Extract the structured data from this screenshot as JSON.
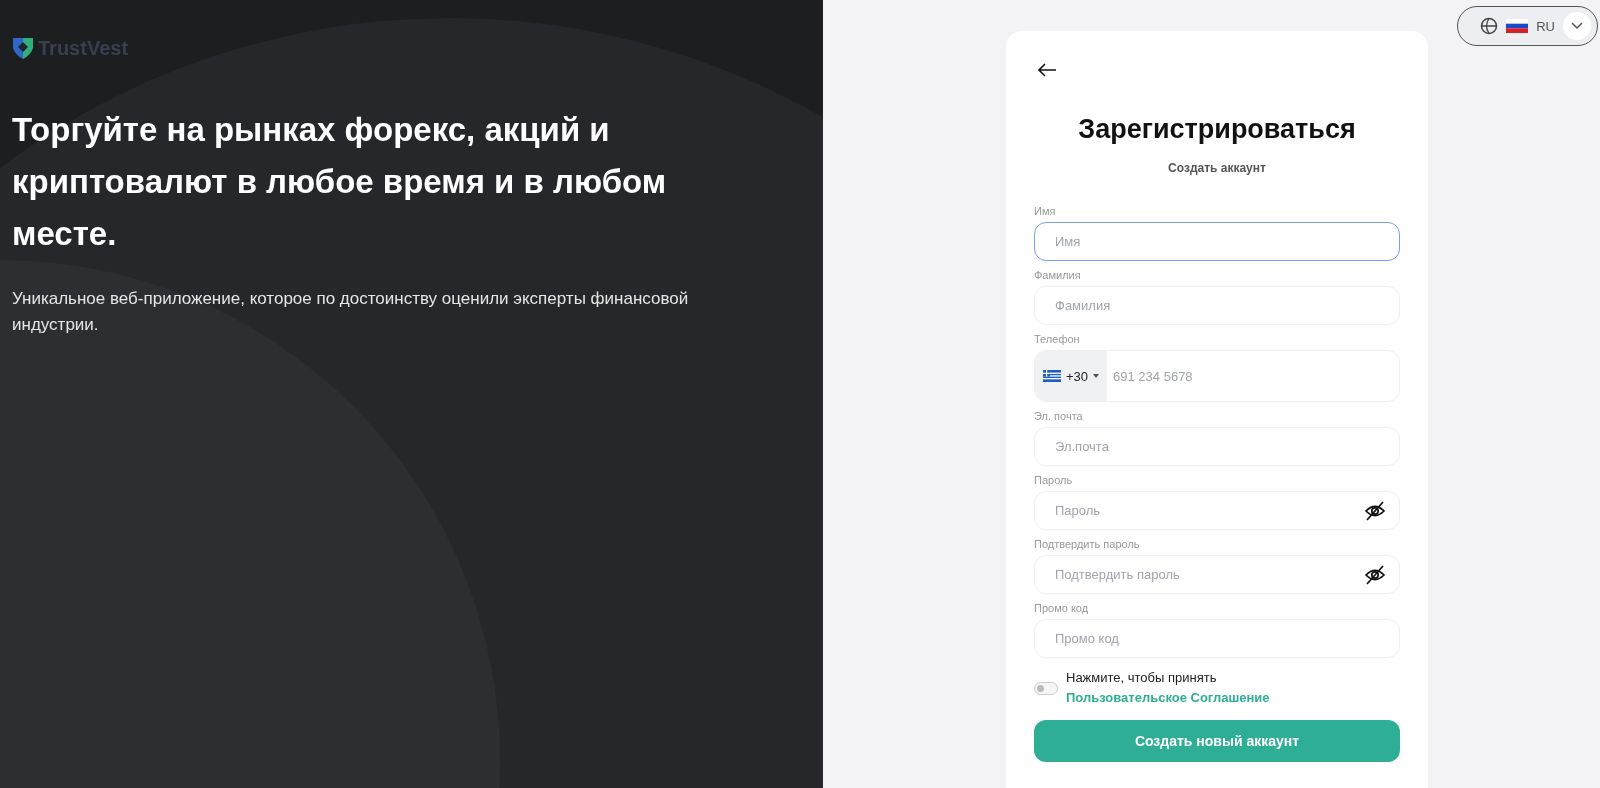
{
  "brand": {
    "name": "TrustVest"
  },
  "hero": {
    "headline": "Торгуйте на рынках форекс, акций и криптовалют в любое время и в любом месте.",
    "text": "Уникальное веб-приложение, которое по достоинству оценили эксперты финансовой индустрии."
  },
  "language": {
    "code": "RU"
  },
  "form": {
    "title": "Зарегистрироваться",
    "subtitle": "Создать аккаунт",
    "fields": [
      {
        "kind": "text",
        "label": "Имя",
        "placeholder": "Имя",
        "focused": true
      },
      {
        "kind": "text",
        "label": "Фамилия",
        "placeholder": "Фамилия",
        "focused": false
      },
      {
        "kind": "phone",
        "label": "Телефон",
        "code": "+30",
        "placeholder": "691 234 5678",
        "focused": false
      },
      {
        "kind": "text",
        "label": "Эл. почта",
        "placeholder": "Эл.почта",
        "focused": false
      },
      {
        "kind": "password",
        "label": "Пароль",
        "placeholder": "Пароль",
        "focused": false
      },
      {
        "kind": "password",
        "label": "Подтвердить пароль",
        "placeholder": "Подтвердить пароль",
        "focused": false
      },
      {
        "kind": "text",
        "label": "Промо код",
        "placeholder": "Промо код",
        "focused": false
      }
    ],
    "agreement": {
      "on": false,
      "text": "Нажмите, чтобы принять",
      "link": "Пользовательское Соглашение"
    },
    "submit": "Создать новый аккаунт"
  }
}
